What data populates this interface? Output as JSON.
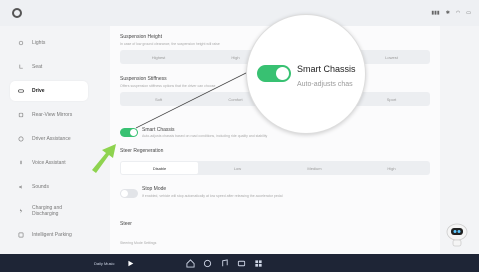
{
  "sidebar": {
    "items": [
      {
        "label": "Lights",
        "icon": "light-icon"
      },
      {
        "label": "Seat",
        "icon": "seat-icon"
      },
      {
        "label": "Drive",
        "icon": "car-icon",
        "active": true
      },
      {
        "label": "Rear-View Mirrors",
        "icon": "mirror-icon"
      },
      {
        "label": "Driver Assistance",
        "icon": "assist-icon"
      },
      {
        "label": "Voice Assistant",
        "icon": "voice-icon"
      },
      {
        "label": "Sounds",
        "icon": "sound-icon"
      },
      {
        "label": "Charging and Discharging",
        "icon": "charging-icon"
      },
      {
        "label": "Intelligent Parking",
        "icon": "parking-icon"
      }
    ]
  },
  "main": {
    "suspension_height": {
      "title": "Suspension Height",
      "description": "In case of low ground clearance, the suspension height will raise",
      "options": [
        "Highest",
        "High",
        "Standard",
        "Lowest"
      ],
      "selected": 2
    },
    "suspension_stiffness": {
      "title": "Suspension Stiffness",
      "description": "Offers suspension stiffness options that the driver can choose",
      "options": [
        "Soft",
        "Comfort",
        "Standard",
        "Sport"
      ],
      "selected": 2
    },
    "smart_chassis": {
      "title": "Smart Chassis",
      "description": "Auto-adjusts chassis based on road conditions, including ride quality and stability",
      "enabled": true
    },
    "steer_regeneration": {
      "title": "Steer Regeneration",
      "options": [
        "Disable",
        "Low",
        "Medium",
        "High"
      ],
      "selected": 0
    },
    "stop_mode": {
      "title": "Stop Mode",
      "description": "If enabled, vehicle will stop automatically at low speed after releasing the accelerator pedal",
      "enabled": false
    },
    "next_section": "Steer",
    "next_desc": "Steering Mode Settings"
  },
  "lens": {
    "title": "Smart Chassis",
    "description": "Auto-adjusts chas"
  },
  "dock": {
    "media_title": "Daily Music",
    "apps": [
      "home-icon",
      "navigation-icon",
      "music-icon",
      "video-icon",
      "apps-icon"
    ]
  },
  "colors": {
    "accent_green": "#38c172",
    "arrow_green": "#8ed34f",
    "dock_bg": "#1e2536"
  }
}
